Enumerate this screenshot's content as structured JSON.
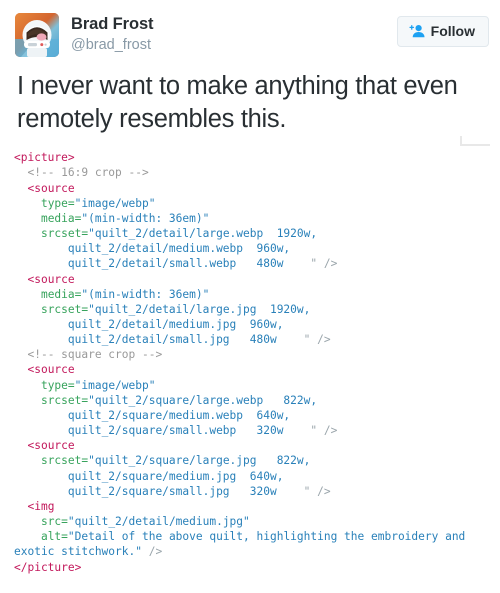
{
  "tweet": {
    "author": {
      "display_name": "Brad Frost",
      "handle": "@brad_frost",
      "avatar_icon": "astronaut-avatar"
    },
    "follow_button": {
      "label": "Follow",
      "icon": "person-add-icon"
    },
    "text": "I never want to make anything that even remotely resembles this."
  },
  "code_block": {
    "language": "html",
    "lines": [
      {
        "indent": 0,
        "segments": [
          {
            "type": "tag",
            "text": "<picture>"
          }
        ]
      },
      {
        "indent": 1,
        "segments": [
          {
            "type": "comment",
            "text": "<!-- 16:9 crop -->"
          }
        ]
      },
      {
        "indent": 1,
        "segments": [
          {
            "type": "tag",
            "text": "<source"
          }
        ]
      },
      {
        "indent": 2,
        "segments": [
          {
            "type": "attr",
            "text": "type="
          },
          {
            "type": "value",
            "text": "\"image/webp\""
          }
        ]
      },
      {
        "indent": 2,
        "segments": [
          {
            "type": "attr",
            "text": "media="
          },
          {
            "type": "value",
            "text": "\"(min-width: 36em)\""
          }
        ]
      },
      {
        "indent": 2,
        "segments": [
          {
            "type": "attr",
            "text": "srcset="
          },
          {
            "type": "value",
            "text": "\"quilt_2/detail/large.webp  1920w,"
          }
        ]
      },
      {
        "indent": 4,
        "segments": [
          {
            "type": "value",
            "text": "quilt_2/detail/medium.webp  960w,"
          }
        ]
      },
      {
        "indent": 4,
        "segments": [
          {
            "type": "value",
            "text": "quilt_2/detail/small.webp   480w"
          },
          {
            "type": "punct",
            "text": "    \" />"
          }
        ]
      },
      {
        "indent": 1,
        "segments": [
          {
            "type": "tag",
            "text": "<source"
          }
        ]
      },
      {
        "indent": 2,
        "segments": [
          {
            "type": "attr",
            "text": "media="
          },
          {
            "type": "value",
            "text": "\"(min-width: 36em)\""
          }
        ]
      },
      {
        "indent": 2,
        "segments": [
          {
            "type": "attr",
            "text": "srcset="
          },
          {
            "type": "value",
            "text": "\"quilt_2/detail/large.jpg  1920w,"
          }
        ]
      },
      {
        "indent": 4,
        "segments": [
          {
            "type": "value",
            "text": "quilt_2/detail/medium.jpg  960w,"
          }
        ]
      },
      {
        "indent": 4,
        "segments": [
          {
            "type": "value",
            "text": "quilt_2/detail/small.jpg   480w"
          },
          {
            "type": "punct",
            "text": "    \" />"
          }
        ]
      },
      {
        "indent": 1,
        "segments": [
          {
            "type": "comment",
            "text": "<!-- square crop -->"
          }
        ]
      },
      {
        "indent": 1,
        "segments": [
          {
            "type": "tag",
            "text": "<source"
          }
        ]
      },
      {
        "indent": 2,
        "segments": [
          {
            "type": "attr",
            "text": "type="
          },
          {
            "type": "value",
            "text": "\"image/webp\""
          }
        ]
      },
      {
        "indent": 2,
        "segments": [
          {
            "type": "attr",
            "text": "srcset="
          },
          {
            "type": "value",
            "text": "\"quilt_2/square/large.webp   822w,"
          }
        ]
      },
      {
        "indent": 4,
        "segments": [
          {
            "type": "value",
            "text": "quilt_2/square/medium.webp  640w,"
          }
        ]
      },
      {
        "indent": 4,
        "segments": [
          {
            "type": "value",
            "text": "quilt_2/square/small.webp   320w"
          },
          {
            "type": "punct",
            "text": "    \" />"
          }
        ]
      },
      {
        "indent": 1,
        "segments": [
          {
            "type": "tag",
            "text": "<source"
          }
        ]
      },
      {
        "indent": 2,
        "segments": [
          {
            "type": "attr",
            "text": "srcset="
          },
          {
            "type": "value",
            "text": "\"quilt_2/square/large.jpg   822w,"
          }
        ]
      },
      {
        "indent": 4,
        "segments": [
          {
            "type": "value",
            "text": "quilt_2/square/medium.jpg  640w,"
          }
        ]
      },
      {
        "indent": 4,
        "segments": [
          {
            "type": "value",
            "text": "quilt_2/square/small.jpg   320w"
          },
          {
            "type": "punct",
            "text": "    \" />"
          }
        ]
      },
      {
        "indent": 1,
        "segments": [
          {
            "type": "tag",
            "text": "<img"
          }
        ]
      },
      {
        "indent": 2,
        "segments": [
          {
            "type": "attr",
            "text": "src="
          },
          {
            "type": "value",
            "text": "\"quilt_2/detail/medium.jpg\""
          }
        ]
      },
      {
        "indent": 2,
        "segments": [
          {
            "type": "attr",
            "text": "alt="
          },
          {
            "type": "value",
            "text": "\"Detail of the above quilt, highlighting the embroidery and exotic stitchwork.\""
          },
          {
            "type": "punct",
            "text": " />"
          }
        ]
      },
      {
        "indent": 0,
        "segments": [
          {
            "type": "tag",
            "text": "</picture>"
          }
        ]
      }
    ]
  },
  "colors": {
    "tag": "#c2185b",
    "comment": "#999999",
    "attribute": "#37a35c",
    "value": "#2980b9",
    "text": "#292f33",
    "handle": "#8899a6",
    "follow_border": "#e1e8ed",
    "follow_background": "#f5f8fa",
    "accent": "#1da1f2"
  }
}
